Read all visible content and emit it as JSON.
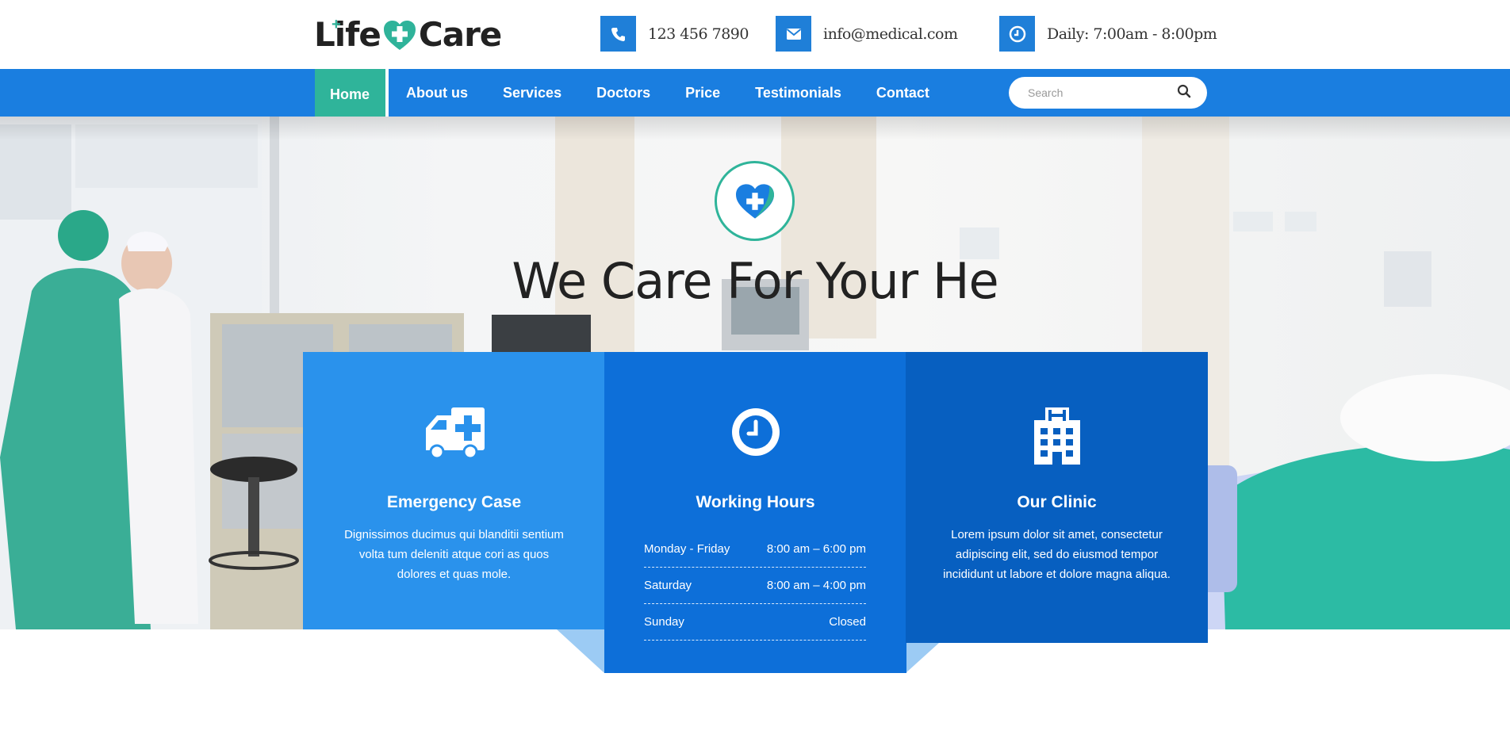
{
  "brand": {
    "logo_left": "Life",
    "logo_right": "Care"
  },
  "contact": {
    "phone": "123 456 7890",
    "email": "info@medical.com",
    "hours": "Daily: 7:00am - 8:00pm"
  },
  "nav": {
    "items": [
      {
        "label": "Home",
        "active": true
      },
      {
        "label": "About us"
      },
      {
        "label": "Services"
      },
      {
        "label": "Doctors"
      },
      {
        "label": "Price"
      },
      {
        "label": "Testimonials"
      },
      {
        "label": "Contact"
      }
    ],
    "search_placeholder": "Search"
  },
  "hero": {
    "title": "We Care For Your He"
  },
  "cards": {
    "emergency": {
      "title": "Emergency Case",
      "text": "Dignissimos ducimus qui blanditii sentium volta tum deleniti atque cori as quos dolores et quas mole."
    },
    "hours": {
      "title": "Working Hours",
      "rows": [
        {
          "day": "Monday - Friday",
          "time": "8:00 am – 6:00 pm"
        },
        {
          "day": "Saturday",
          "time": "8:00 am – 4:00 pm"
        },
        {
          "day": "Sunday",
          "time": "Closed"
        }
      ]
    },
    "clinic": {
      "title": "Our Clinic",
      "text": "Lorem ipsum dolor sit amet, consectetur adipiscing elit, sed do eiusmod tempor incididunt ut labore et dolore magna aliqua."
    }
  },
  "colors": {
    "primary": "#1a7ee0",
    "accent": "#2fb49a",
    "card_light": "#2a92ec",
    "card_mid": "#0d6fd9",
    "card_dark": "#075fc0"
  },
  "icons": {
    "phone": "phone-icon",
    "email": "envelope-icon",
    "hours": "clock-icon",
    "search": "search-icon",
    "emergency": "ambulance-icon",
    "working_hours": "clock-icon",
    "clinic": "hospital-icon",
    "hero_badge": "heart-plus-icon"
  }
}
